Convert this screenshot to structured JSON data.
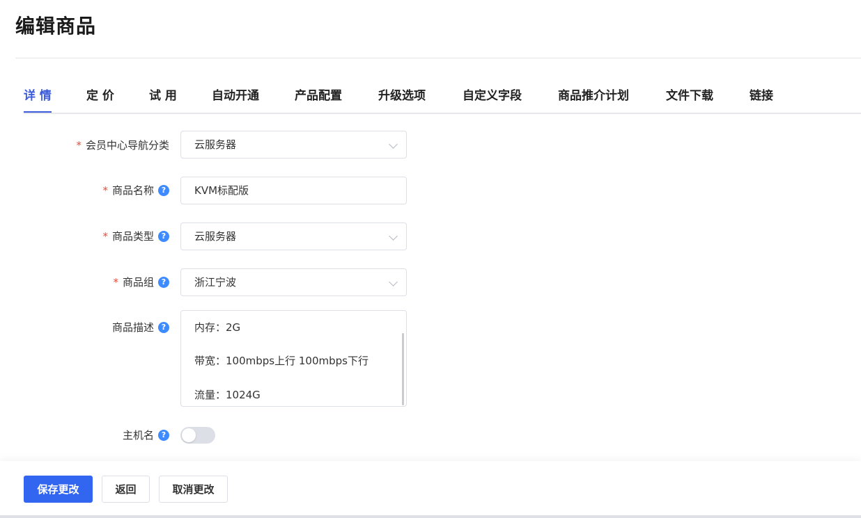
{
  "page": {
    "title": "编辑商品"
  },
  "tabs": [
    {
      "label": "详 情",
      "active": true
    },
    {
      "label": "定 价"
    },
    {
      "label": "试 用"
    },
    {
      "label": "自动开通"
    },
    {
      "label": "产品配置"
    },
    {
      "label": "升级选项"
    },
    {
      "label": "自定义字段"
    },
    {
      "label": "商品推介计划"
    },
    {
      "label": "文件下载"
    },
    {
      "label": "链接"
    }
  ],
  "form": {
    "nav_category": {
      "label": "会员中心导航分类",
      "required": true,
      "value": "云服务器"
    },
    "product_name": {
      "label": "商品名称",
      "required": true,
      "value": "KVM标配版"
    },
    "product_type": {
      "label": "商品类型",
      "required": true,
      "value": "云服务器"
    },
    "product_group": {
      "label": "商品组",
      "required": true,
      "value": "浙江宁波"
    },
    "description": {
      "label": "商品描述",
      "lines": [
        "内存：2G",
        "带宽：100mbps上行 100mbps下行",
        "流量：1024G"
      ]
    },
    "hostname": {
      "label": "主机名",
      "enabled": false
    }
  },
  "footer": {
    "save_label": "保存更改",
    "back_label": "返回",
    "cancel_label": "取消更改"
  },
  "colors": {
    "accent": "#3b5bdb",
    "primary_button": "#3366f0",
    "required": "#e74c3c",
    "help_icon": "#3d8bff"
  }
}
